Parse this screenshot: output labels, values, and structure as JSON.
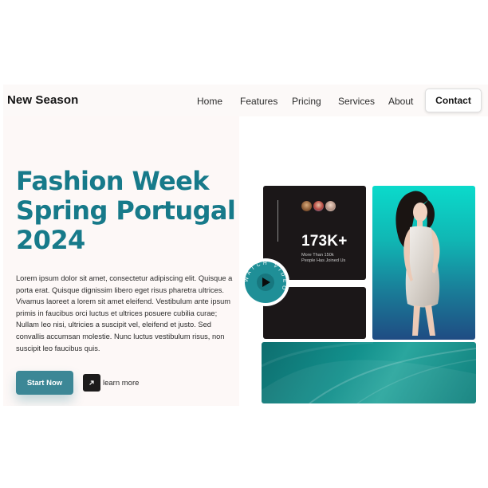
{
  "brand": {
    "name": "New Season"
  },
  "nav": {
    "links": [
      "Home",
      "Features",
      "Pricing",
      "Services",
      "About"
    ],
    "contact": "Contact"
  },
  "hero": {
    "title_lines": [
      "Fashion Week",
      "Spring Portugal",
      "2024"
    ],
    "body": "Lorem ipsum dolor sit amet, consectetur adipiscing elit. Quisque a porta erat. Quisque dignissim libero eget risus pharetra ultrices. Vivamus laoreet a lorem sit amet eleifend. Vestibulum ante ipsum primis in faucibus orci luctus et ultrices posuere cubilia curae; Nullam leo nisi, ultricies a suscipit vel, eleifend et justo. Sed convallis accumsan molestie. Nunc luctus vestibulum risus, non suscipit leo faucibus quis.",
    "cta_primary": "Start Now",
    "cta_secondary": "learn more",
    "cta_secondary_icon": "arrow-up-right-icon"
  },
  "stats": {
    "number": "173K+",
    "caption_line1": "More Than 150k",
    "caption_line2": "People Has Joined Us"
  },
  "video_badge": {
    "text": "WATCH VIDEO",
    "icon": "play-icon"
  },
  "colors": {
    "accent": "#177a8a",
    "button": "#3c8796",
    "dark_card": "#1b1718",
    "teal": "#12a9a4"
  }
}
